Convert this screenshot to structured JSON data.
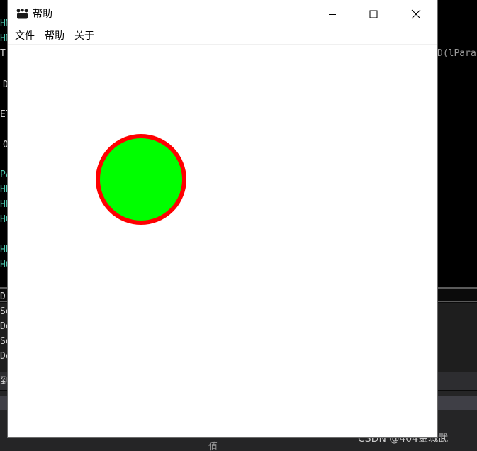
{
  "window": {
    "title": "帮助",
    "icon": "paw-icon"
  },
  "menu": {
    "items": [
      "文件",
      "帮助",
      "关于"
    ]
  },
  "canvas": {
    "shapes": [
      {
        "kind": "circle",
        "fill": "#00ff00",
        "stroke": "#ff0000"
      }
    ]
  },
  "background_ide": {
    "code_fragments": [
      "HM",
      "HM",
      "Tr",
      "D",
      "El",
      "O",
      "PA",
      "HD",
      "HP",
      "HG",
      "HB",
      "HG"
    ],
    "right_fragment": "D(lPara",
    "output_fragments": [
      "Dr",
      "Se",
      "De",
      "Se",
      "De"
    ],
    "panel_bar_fragment": "到",
    "value_label": "值"
  },
  "watermark": "CSDN @404金城武",
  "colors": {
    "code_text": "#4ec9b0",
    "window_bg": "#ffffff",
    "ide_bg": "#000000"
  }
}
